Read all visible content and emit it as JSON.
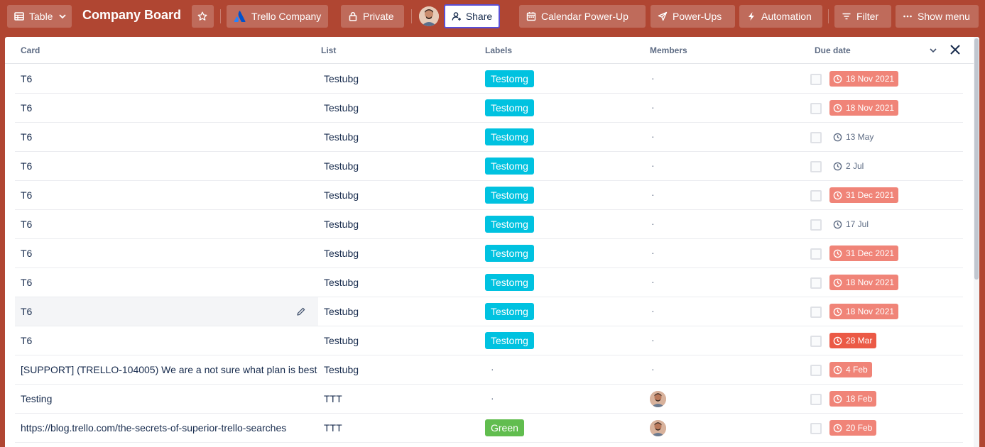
{
  "topbar": {
    "view_label": "Table",
    "board_title": "Company Board",
    "workspace_label": "Trello Company",
    "visibility_label": "Private",
    "share_label": "Share",
    "calendar_label": "Calendar Power-Up",
    "powerups_label": "Power-Ups",
    "automation_label": "Automation",
    "filter_label": "Filter",
    "menu_label": "Show menu"
  },
  "table": {
    "headers": {
      "card": "Card",
      "list": "List",
      "labels": "Labels",
      "members": "Members",
      "due": "Due date"
    },
    "rows": [
      {
        "card": "T6",
        "list": "Testubg",
        "label": "Testomg",
        "label_color": "#00c2e0",
        "member": "·",
        "due": "18 Nov 2021",
        "due_style": "overdue"
      },
      {
        "card": "T6",
        "list": "Testubg",
        "label": "Testomg",
        "label_color": "#00c2e0",
        "member": "·",
        "due": "18 Nov 2021",
        "due_style": "overdue"
      },
      {
        "card": "T6",
        "list": "Testubg",
        "label": "Testomg",
        "label_color": "#00c2e0",
        "member": "·",
        "due": "13 May",
        "due_style": "plain"
      },
      {
        "card": "T6",
        "list": "Testubg",
        "label": "Testomg",
        "label_color": "#00c2e0",
        "member": "·",
        "due": "2 Jul",
        "due_style": "plain"
      },
      {
        "card": "T6",
        "list": "Testubg",
        "label": "Testomg",
        "label_color": "#00c2e0",
        "member": "·",
        "due": "31 Dec 2021",
        "due_style": "overdue"
      },
      {
        "card": "T6",
        "list": "Testubg",
        "label": "Testomg",
        "label_color": "#00c2e0",
        "member": "·",
        "due": "17 Jul",
        "due_style": "plain"
      },
      {
        "card": "T6",
        "list": "Testubg",
        "label": "Testomg",
        "label_color": "#00c2e0",
        "member": "·",
        "due": "31 Dec 2021",
        "due_style": "overdue"
      },
      {
        "card": "T6",
        "list": "Testubg",
        "label": "Testomg",
        "label_color": "#00c2e0",
        "member": "·",
        "due": "18 Nov 2021",
        "due_style": "overdue"
      },
      {
        "card": "T6",
        "list": "Testubg",
        "label": "Testomg",
        "label_color": "#00c2e0",
        "member": "·",
        "due": "18 Nov 2021",
        "due_style": "overdue",
        "hover": true
      },
      {
        "card": "T6",
        "list": "Testubg",
        "label": "Testomg",
        "label_color": "#00c2e0",
        "member": "·",
        "due": "28 Mar",
        "due_style": "due-soon"
      },
      {
        "card": "[SUPPORT] (TRELLO-104005) We are a not sure what plan is best",
        "list": "Testubg",
        "label": "·",
        "label_color": "",
        "member": "·",
        "due": "4 Feb",
        "due_style": "overdue"
      },
      {
        "card": "Testing",
        "list": "TTT",
        "label": "·",
        "label_color": "",
        "member": "avatar",
        "due": "18 Feb",
        "due_style": "overdue"
      },
      {
        "card": "https://blog.trello.com/the-secrets-of-superior-trello-searches",
        "list": "TTT",
        "label": "Green",
        "label_color": "#61bd4f",
        "member": "avatar",
        "due": "20 Feb",
        "due_style": "overdue"
      }
    ]
  },
  "colors": {
    "board_bg": "#b04632",
    "overdue": "#f08478",
    "due_soon": "#eb5a46",
    "share_border": "#5a4fd6"
  }
}
